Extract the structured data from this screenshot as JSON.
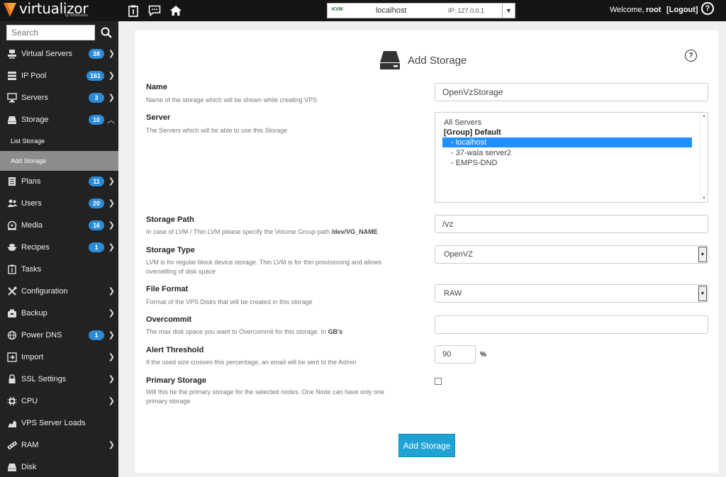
{
  "header": {
    "brand": "virtualizor",
    "brand_sub": "by softaculous",
    "server_selector": {
      "virt_type": "KVM",
      "host": "localhost",
      "ip": "IP: 127.0.0.1"
    },
    "welcome_text": "Welcome,",
    "username": "root",
    "logout_label": "[Logout]",
    "help_label": "?"
  },
  "sidebar": {
    "search_placeholder": "Search",
    "items": [
      {
        "label": "Virtual Servers",
        "badge": "38",
        "icon": "virtual-servers-icon"
      },
      {
        "label": "IP Pool",
        "badge": "161",
        "icon": "ip-pool-icon"
      },
      {
        "label": "Servers",
        "badge": "3",
        "icon": "servers-icon"
      },
      {
        "label": "Storage",
        "badge": "10",
        "icon": "storage-icon",
        "expanded": true
      },
      {
        "label": "Plans",
        "badge": "11",
        "icon": "plans-icon"
      },
      {
        "label": "Users",
        "badge": "20",
        "icon": "users-icon"
      },
      {
        "label": "Media",
        "badge": "16",
        "icon": "media-icon"
      },
      {
        "label": "Recipes",
        "badge": "1",
        "icon": "recipes-icon"
      },
      {
        "label": "Tasks",
        "icon": "tasks-icon"
      },
      {
        "label": "Configuration",
        "icon": "configuration-icon"
      },
      {
        "label": "Backup",
        "icon": "backup-icon"
      },
      {
        "label": "Power DNS",
        "badge": "1",
        "icon": "power-dns-icon"
      },
      {
        "label": "Import",
        "icon": "import-icon"
      },
      {
        "label": "SSL Settings",
        "icon": "ssl-icon"
      },
      {
        "label": "CPU",
        "icon": "cpu-icon"
      },
      {
        "label": "VPS Server Loads",
        "icon": "server-loads-icon"
      },
      {
        "label": "RAM",
        "icon": "ram-icon"
      },
      {
        "label": "Disk",
        "icon": "disk-icon"
      }
    ],
    "storage_sub": [
      "List Storage",
      "Add Storage"
    ]
  },
  "form": {
    "title": "Add Storage",
    "help_label": "?",
    "name": {
      "label": "Name",
      "desc": "Name of the storage which will be shown while creating VPS",
      "value": "OpenVzStorage"
    },
    "server": {
      "label": "Server",
      "desc": "The Servers which will be able to use this Storage",
      "options": [
        "All Servers",
        "[Group] Default",
        "- localhost",
        "- 37-wala server2",
        "- EMPS-DND"
      ],
      "selected_index": 2
    },
    "storage_path": {
      "label": "Storage Path",
      "desc": "In case of LVM / Thin LVM please specify the Volume Group path",
      "desc_code": "/dev/VG_NAME",
      "value": "/vz"
    },
    "storage_type": {
      "label": "Storage Type",
      "desc": "LVM is for regular block device storage. Thin LVM is for thin provisioning and allows overselling of disk space",
      "value": "OpenVZ"
    },
    "file_format": {
      "label": "File Format",
      "desc": "Format of the VPS Disks that will be created in this storage",
      "value": "RAW"
    },
    "overcommit": {
      "label": "Overcommit",
      "desc": "The max disk space you want to Overcommit for this storage. In",
      "desc_unit": "GB's",
      "value": ""
    },
    "alert_threshold": {
      "label": "Alert Threshold",
      "desc": "If the used size crosses this percentage, an email will be sent to the Admin",
      "value": "90",
      "unit": "%"
    },
    "primary_storage": {
      "label": "Primary Storage",
      "desc": "Will this be the primary storage for the selected nodes. One Node can have only one primary storage",
      "checked": false
    },
    "submit_label": "Add Storage"
  }
}
